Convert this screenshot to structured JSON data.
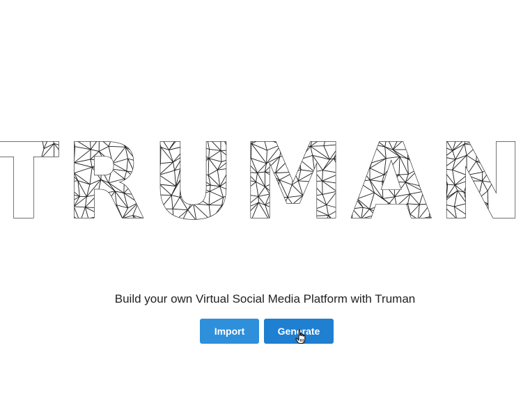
{
  "logo": {
    "text": "TRUMAN"
  },
  "tagline": "Build your own Virtual Social Media Platform with Truman",
  "buttons": {
    "import_label": "Import",
    "generate_label": "Generate"
  },
  "colors": {
    "button_primary": "#2e8fdb",
    "button_hover": "#1f7fd1",
    "logo_stroke": "#1a1a1a",
    "background": "#ffffff"
  },
  "icons": {
    "cursor": "hand-pointer-icon"
  }
}
